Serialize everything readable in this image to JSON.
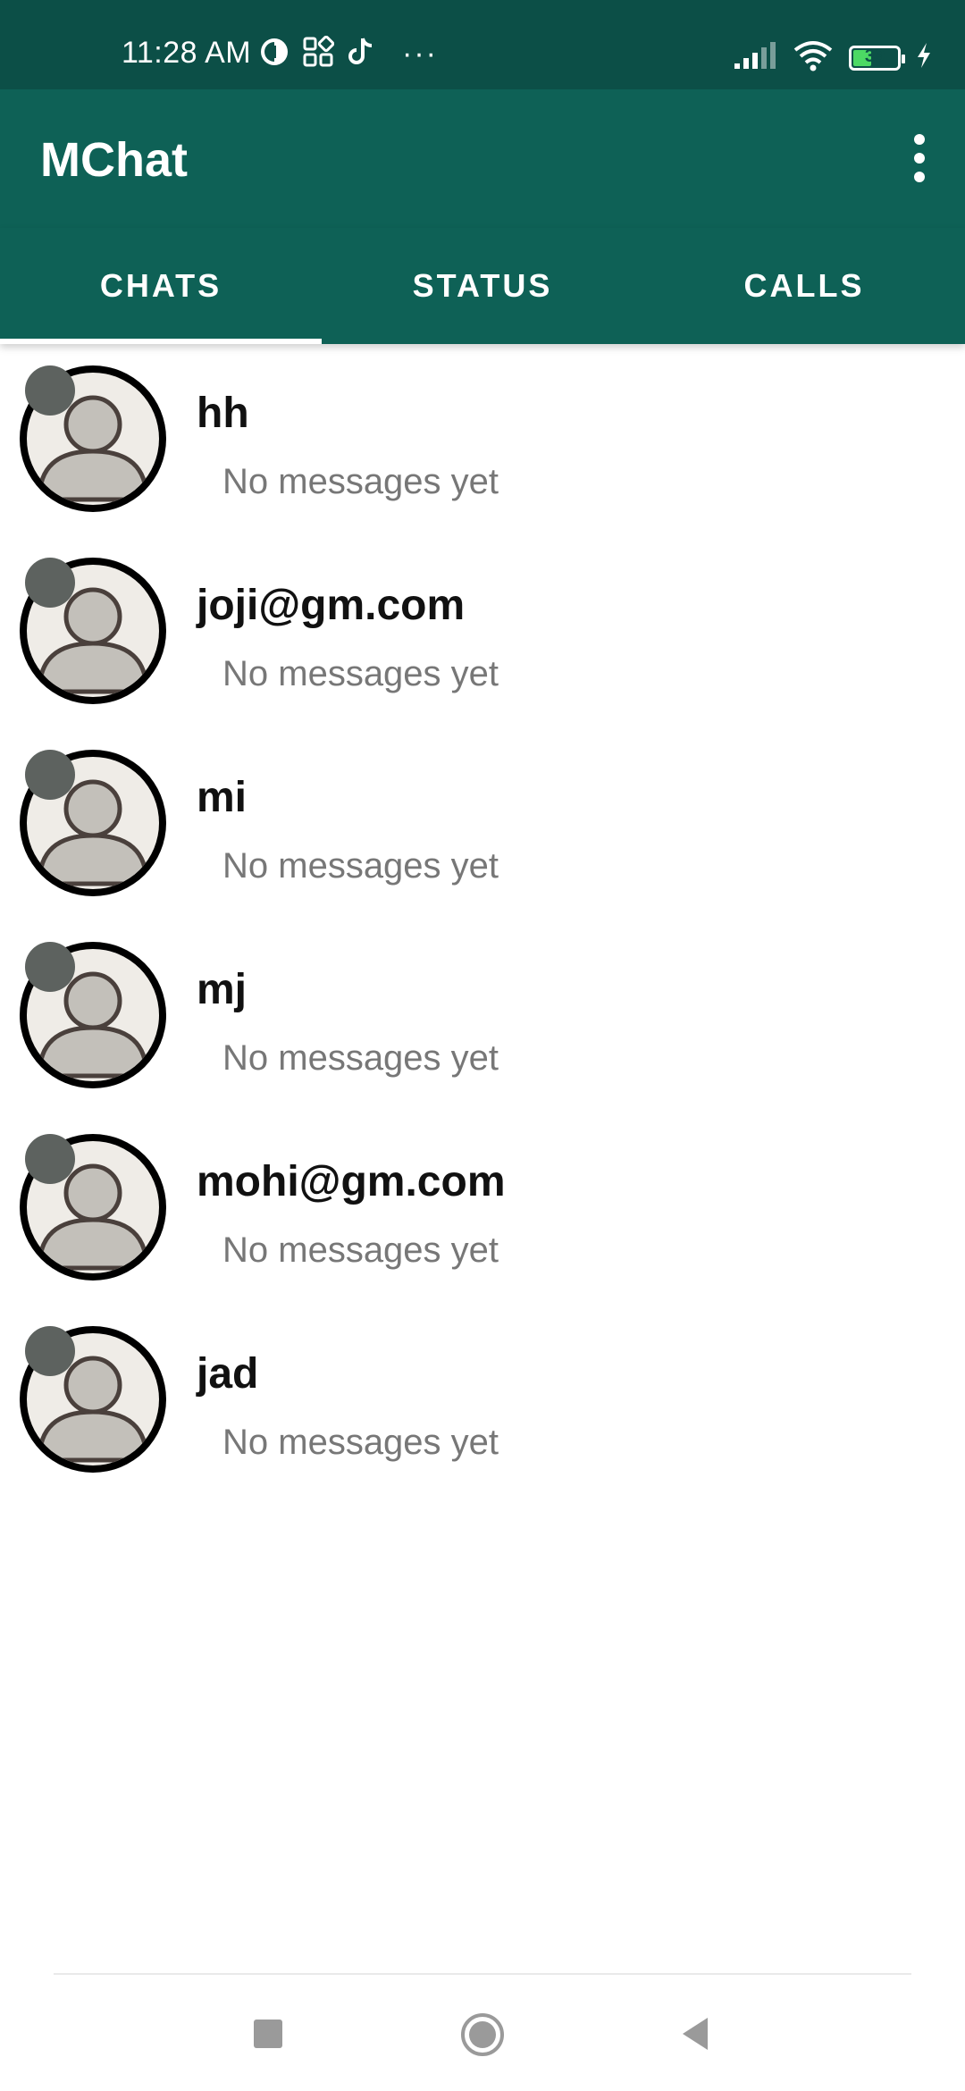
{
  "status_bar": {
    "time": "11:28 AM",
    "more_indicator": "···",
    "battery_level": 39,
    "battery_text": "39",
    "icons": [
      "data-saver-icon",
      "apps-grid-icon",
      "tiktok-icon",
      "signal-icon",
      "wifi-icon",
      "battery-icon",
      "charging-icon"
    ]
  },
  "app_bar": {
    "title": "MChat",
    "menu_icon": "more-vert-icon"
  },
  "tabs": [
    {
      "label": "CHATS",
      "active": true
    },
    {
      "label": "STATUS",
      "active": false
    },
    {
      "label": "CALLS",
      "active": false
    }
  ],
  "chats": [
    {
      "name": "hh",
      "preview": "No messages yet"
    },
    {
      "name": "joji@gm.com",
      "preview": "No messages yet"
    },
    {
      "name": "mi",
      "preview": "No messages yet"
    },
    {
      "name": "mj",
      "preview": "No messages yet"
    },
    {
      "name": "mohi@gm.com",
      "preview": "No messages yet"
    },
    {
      "name": "jad",
      "preview": "No messages yet"
    }
  ],
  "colors": {
    "status_bar": "#0c4f47",
    "primary": "#0e6156",
    "status_dot": "#5d625f",
    "preview_text": "#777777"
  },
  "nav_bar": {
    "icons": [
      "recents-square-icon",
      "home-circle-icon",
      "back-triangle-icon"
    ]
  }
}
